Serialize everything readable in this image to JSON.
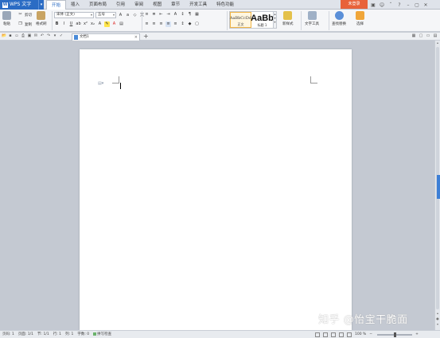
{
  "app": {
    "name": "WPS 文字"
  },
  "menu": [
    {
      "label": "开始",
      "active": true
    },
    {
      "label": "插入"
    },
    {
      "label": "页面布局"
    },
    {
      "label": "引用"
    },
    {
      "label": "审阅"
    },
    {
      "label": "视图"
    },
    {
      "label": "章节"
    },
    {
      "label": "开发工具"
    },
    {
      "label": "特色功能"
    }
  ],
  "login_label": "未登录",
  "ribbon": {
    "paste": "粘贴",
    "cut": "剪切",
    "copy": "复制",
    "format_painter": "格式刷",
    "font_name": "宋体 (正文)",
    "font_size": "五号",
    "styles": [
      {
        "sample": "AaBbCcDd",
        "name": "正文",
        "selected": true
      },
      {
        "sample": "AaBb",
        "name": "标题 1"
      }
    ],
    "new_style": "新样式",
    "text_tools": "文字工具",
    "find_replace": "查找替换",
    "select": "选择"
  },
  "doc_tab": {
    "label": "文档1"
  },
  "status": {
    "page": "页码: 1",
    "pages": "页面: 1/1",
    "section": "节: 1/1",
    "row": "行: 1",
    "col": "列: 1",
    "words": "字数: 0",
    "spell": "拼写检查",
    "zoom": "100 %"
  },
  "zoom_level": 0.5,
  "watermark": "知乎 @怡宝干脆面",
  "colors": {
    "accent": "#2b6cc4",
    "login": "#e8623a"
  }
}
